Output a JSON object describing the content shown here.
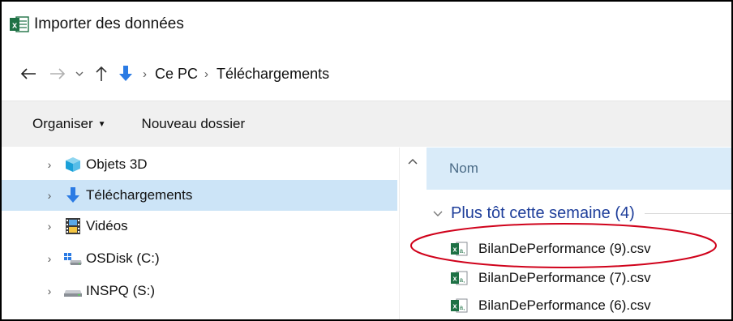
{
  "window": {
    "title": "Importer des données",
    "app_icon": "excel-icon"
  },
  "address": {
    "back_icon": "arrow-left-icon",
    "forward_icon": "arrow-right-icon",
    "recent_icon": "chevron-down-icon",
    "up_icon": "arrow-up-icon",
    "location_icon": "downloads-arrow-icon",
    "breadcrumbs": [
      "Ce PC",
      "Téléchargements"
    ]
  },
  "command": {
    "organize": "Organiser",
    "new_folder": "Nouveau dossier"
  },
  "nav": {
    "items": [
      {
        "label": "Objets 3D",
        "icon": "cube-3d-icon",
        "selected": false
      },
      {
        "label": "Téléchargements",
        "icon": "downloads-arrow-icon",
        "selected": true
      },
      {
        "label": "Vidéos",
        "icon": "film-icon",
        "selected": false
      },
      {
        "label": "OSDisk (C:)",
        "icon": "windows-drive-icon",
        "selected": false
      },
      {
        "label": "INSPQ (S:)",
        "icon": "network-drive-icon",
        "selected": false
      }
    ]
  },
  "content": {
    "column_name": "Nom",
    "group": "Plus tôt cette semaine (4)",
    "files": [
      {
        "name": "BilanDePerformance (9).csv",
        "icon": "excel-csv-icon",
        "highlighted": true
      },
      {
        "name": "BilanDePerformance (7).csv",
        "icon": "excel-csv-icon",
        "highlighted": false
      },
      {
        "name": "BilanDePerformance (6).csv",
        "icon": "excel-csv-icon",
        "highlighted": false
      }
    ]
  },
  "colors": {
    "selection": "#cce4f7",
    "header": "#d9ebf9",
    "group_text": "#1e3e9a",
    "annotation": "#d0021b",
    "excel_green": "#1e7145",
    "download_blue": "#2b7be4"
  }
}
